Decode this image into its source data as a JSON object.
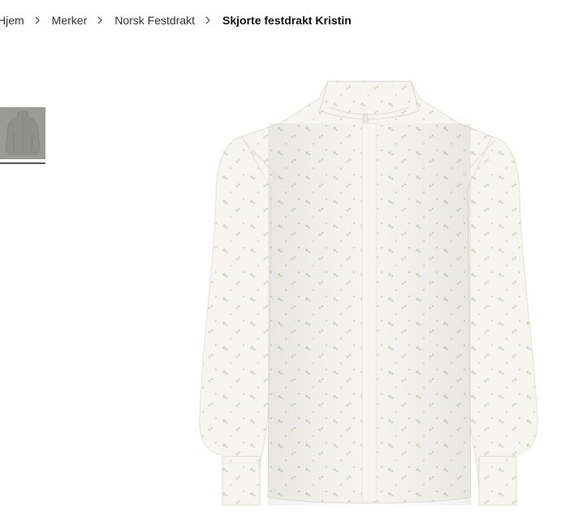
{
  "breadcrumb": {
    "items": [
      {
        "label": "Hjem"
      },
      {
        "label": "Merker"
      },
      {
        "label": "Norsk Festdrakt"
      },
      {
        "label": "Skjorte festdrakt Kristin"
      }
    ]
  },
  "gallery": {
    "thumbnails_count": 1,
    "selected_index": 0
  },
  "colors": {
    "thumb_bg": "#9a9b97",
    "shirt": "#f5f4ee",
    "floral_green": "#cfdcb4",
    "floral_blue": "#c3d4e6"
  }
}
